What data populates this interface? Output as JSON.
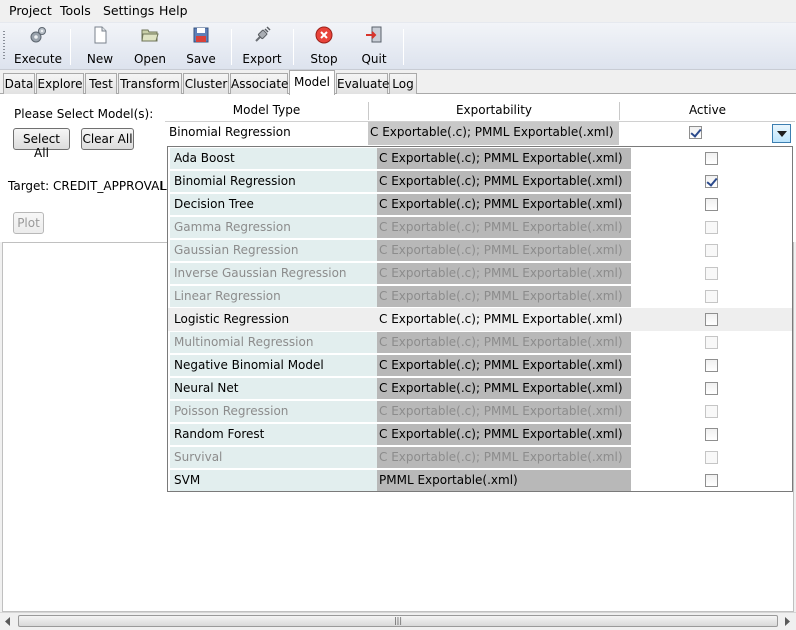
{
  "menu": [
    "Project",
    "Tools",
    "Settings",
    "Help"
  ],
  "toolbar": {
    "execute": "Execute",
    "new": "New",
    "open": "Open",
    "save": "Save",
    "export": "Export",
    "stop": "Stop",
    "quit": "Quit"
  },
  "tabs": [
    "Data",
    "Explore",
    "Test",
    "Transform",
    "Cluster",
    "Associate",
    "Model",
    "Evaluate",
    "Log"
  ],
  "active_tab": "Model",
  "panel": {
    "select_prompt": "Please Select Model(s):",
    "select_all": "Select All",
    "clear_all": "Clear All",
    "target": "Target: CREDIT_APPROVAL",
    "target_suffix": "L",
    "plot": "Plot"
  },
  "table": {
    "headers": [
      "Model Type",
      "Exportability",
      "Active"
    ],
    "edit_row": {
      "name": "Binomial Regression",
      "export": "C Exportable(.c); PMML Exportable(.xml)",
      "active": true
    }
  },
  "models": [
    {
      "name": "Ada Boost",
      "export": "C Exportable(.c); PMML Exportable(.xml)",
      "active": false,
      "enabled": true,
      "highlight": false
    },
    {
      "name": "Binomial Regression",
      "export": "C Exportable(.c); PMML Exportable(.xml)",
      "active": true,
      "enabled": true,
      "highlight": false
    },
    {
      "name": "Decision Tree",
      "export": "C Exportable(.c); PMML Exportable(.xml)",
      "active": false,
      "enabled": true,
      "highlight": false
    },
    {
      "name": "Gamma Regression",
      "export": "C Exportable(.c); PMML Exportable(.xml)",
      "active": false,
      "enabled": false,
      "highlight": false
    },
    {
      "name": "Gaussian Regression",
      "export": "C Exportable(.c); PMML Exportable(.xml)",
      "active": false,
      "enabled": false,
      "highlight": false
    },
    {
      "name": "Inverse Gaussian Regression",
      "export": "C Exportable(.c); PMML Exportable(.xml)",
      "active": false,
      "enabled": false,
      "highlight": false
    },
    {
      "name": "Linear Regression",
      "export": "C Exportable(.c); PMML Exportable(.xml)",
      "active": false,
      "enabled": false,
      "highlight": false
    },
    {
      "name": "Logistic Regression",
      "export": "C Exportable(.c); PMML Exportable(.xml)",
      "active": false,
      "enabled": true,
      "highlight": true
    },
    {
      "name": "Multinomial Regression",
      "export": "C Exportable(.c); PMML Exportable(.xml)",
      "active": false,
      "enabled": false,
      "highlight": false
    },
    {
      "name": "Negative Binomial Model",
      "export": "C Exportable(.c); PMML Exportable(.xml)",
      "active": false,
      "enabled": true,
      "highlight": false
    },
    {
      "name": "Neural Net",
      "export": "C Exportable(.c); PMML Exportable(.xml)",
      "active": false,
      "enabled": true,
      "highlight": false
    },
    {
      "name": "Poisson Regression",
      "export": "C Exportable(.c); PMML Exportable(.xml)",
      "active": false,
      "enabled": false,
      "highlight": false
    },
    {
      "name": "Random Forest",
      "export": "C Exportable(.c); PMML Exportable(.xml)",
      "active": false,
      "enabled": true,
      "highlight": false
    },
    {
      "name": "Survival",
      "export": "C Exportable(.c); PMML Exportable(.xml)",
      "active": false,
      "enabled": false,
      "highlight": false
    },
    {
      "name": "SVM",
      "export": "PMML Exportable(.xml)",
      "active": false,
      "enabled": true,
      "highlight": false
    }
  ],
  "scrollbar": {
    "grip": "|||"
  },
  "icons": {
    "execute": "gears-icon",
    "new": "new-document-icon",
    "open": "folder-open-icon",
    "save": "floppy-disk-icon",
    "export": "plug-export-icon",
    "stop": "stop-sign-icon",
    "quit": "exit-door-icon"
  }
}
